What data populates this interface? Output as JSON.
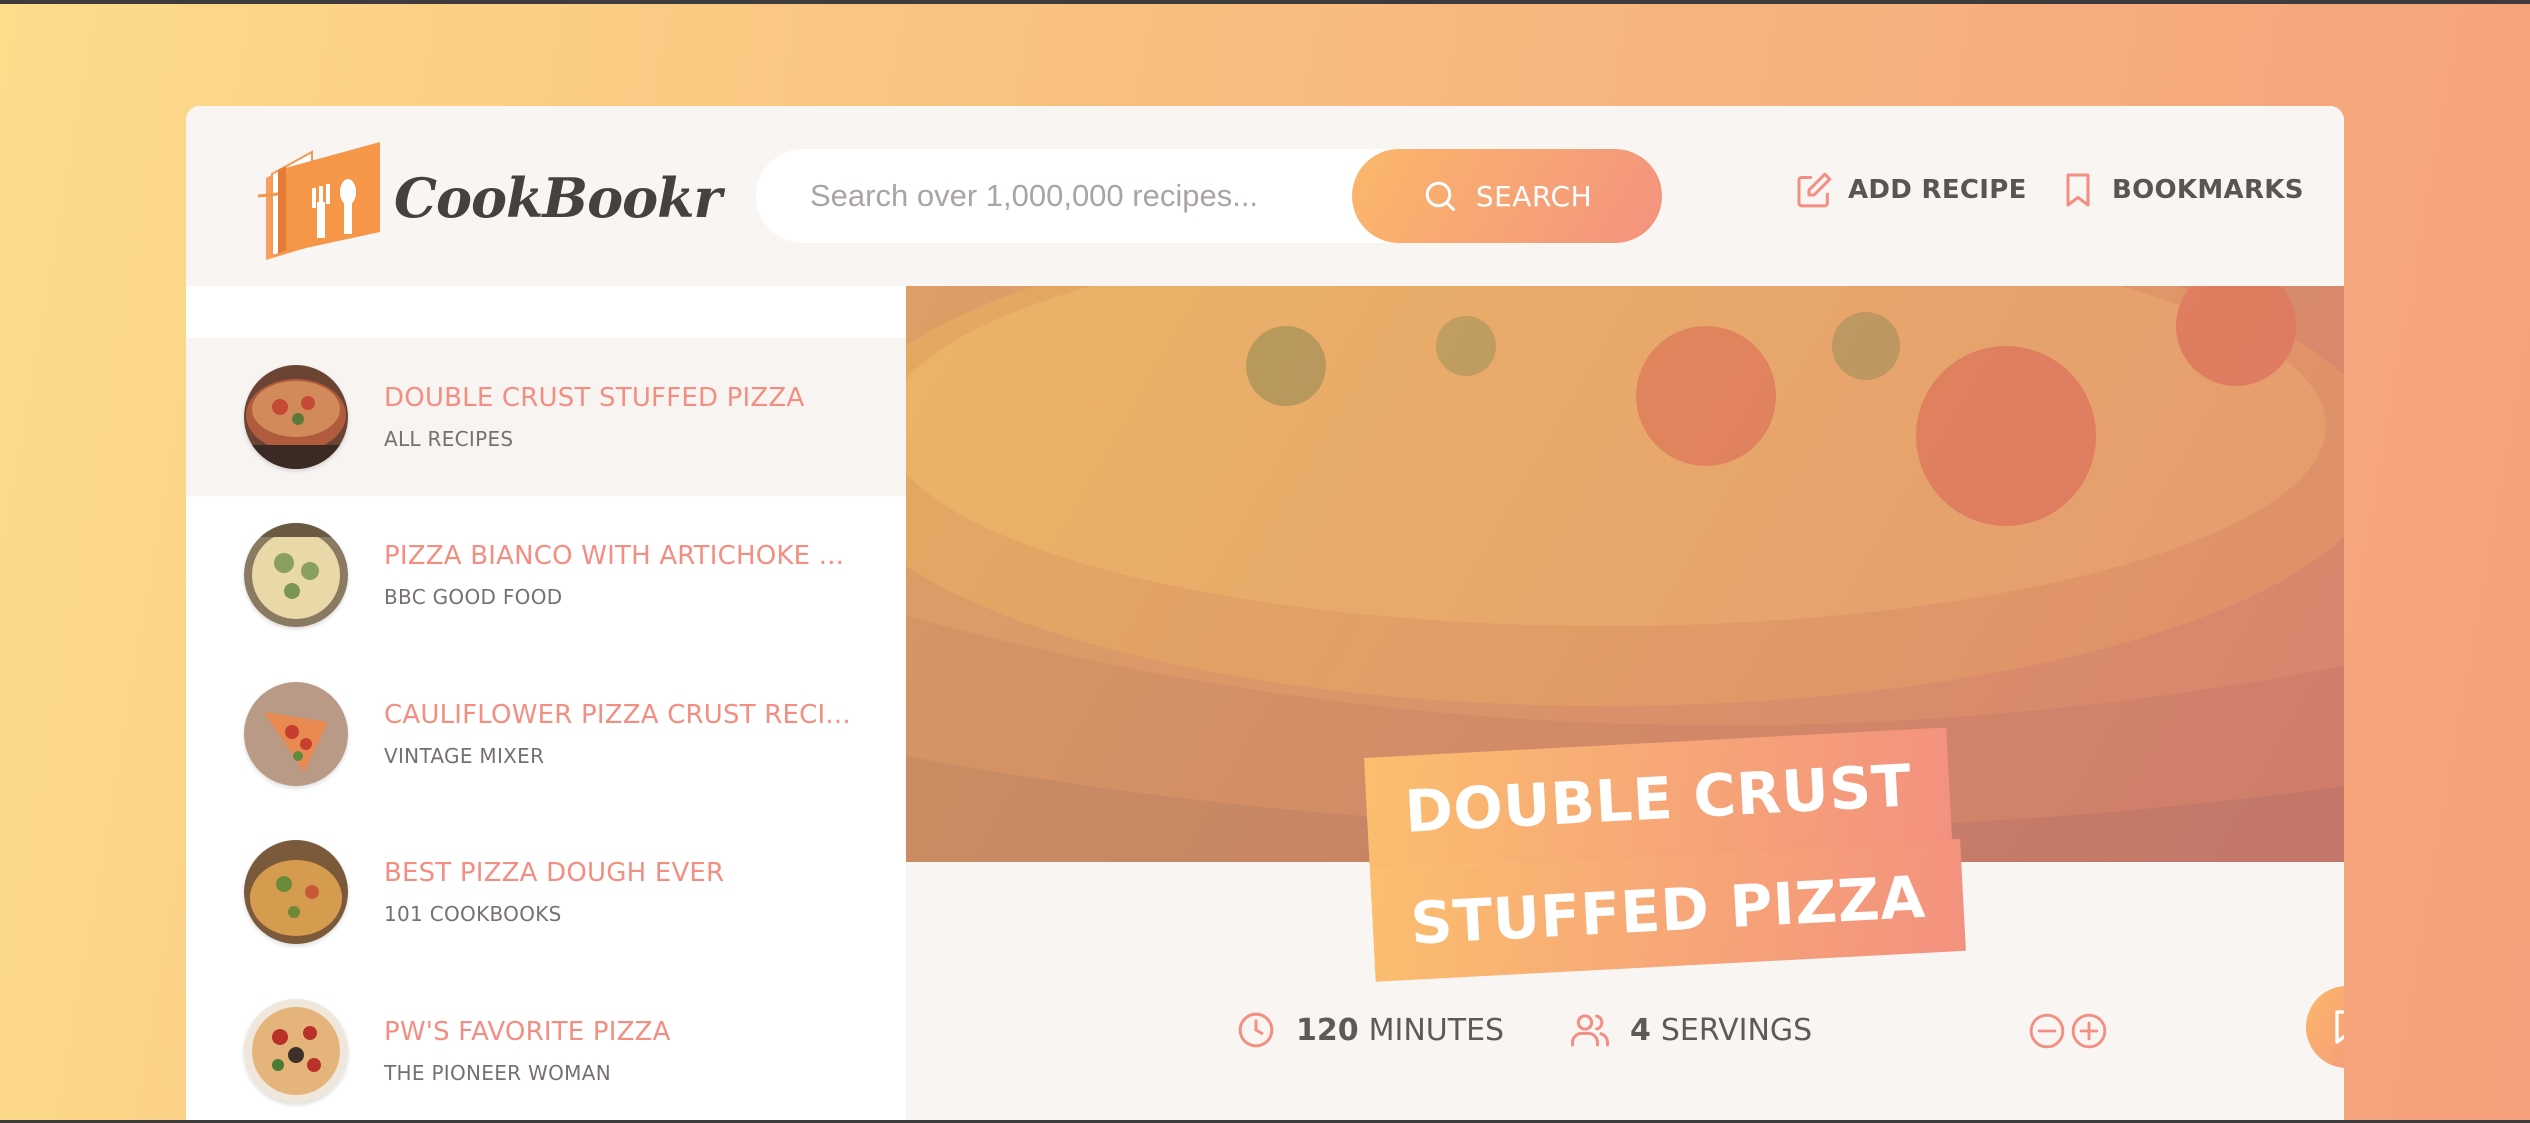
{
  "app": {
    "logo_text": "CookBookr"
  },
  "search": {
    "placeholder": "Search over 1,000,000 recipes...",
    "button_label": "SEARCH"
  },
  "nav": {
    "add_recipe": "ADD RECIPE",
    "bookmarks": "BOOKMARKS"
  },
  "results": [
    {
      "title": "DOUBLE CRUST STUFFED PIZZA",
      "publisher": "ALL RECIPES",
      "active": true
    },
    {
      "title": "PIZZA BIANCO WITH ARTICHOKE ...",
      "publisher": "BBC GOOD FOOD",
      "active": false
    },
    {
      "title": "CAULIFLOWER PIZZA CRUST RECI...",
      "publisher": "VINTAGE MIXER",
      "active": false
    },
    {
      "title": "BEST PIZZA DOUGH EVER",
      "publisher": "101 COOKBOOKS",
      "active": false
    },
    {
      "title": "PW'S FAVORITE PIZZA",
      "publisher": "THE PIONEER WOMAN",
      "active": false
    }
  ],
  "recipe": {
    "title_line1": "DOUBLE CRUST",
    "title_line2": "STUFFED PIZZA",
    "minutes": "120",
    "minutes_unit": "MINUTES",
    "servings": "4",
    "servings_unit": "SERVINGS"
  },
  "colors": {
    "accent": "#f38e82",
    "gradient_start": "#fbbe6e",
    "gradient_end": "#f3917f"
  }
}
